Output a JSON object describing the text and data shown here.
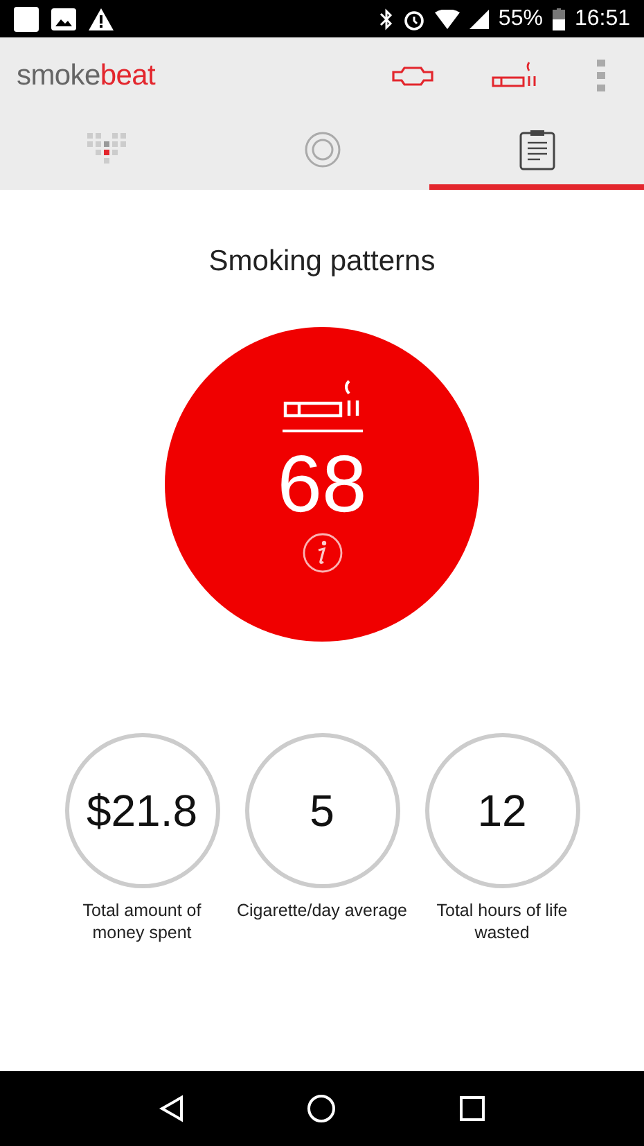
{
  "status_bar": {
    "battery": "55%",
    "time": "16:51"
  },
  "app_bar": {
    "logo_first": "smoke",
    "logo_second": "beat"
  },
  "tabs": [
    {
      "kind": "heart",
      "selected": false
    },
    {
      "kind": "ring",
      "selected": false
    },
    {
      "kind": "clipboard",
      "selected": true
    }
  ],
  "title": "Smoking patterns",
  "main_count": "68",
  "stats": [
    {
      "value": "$21.8",
      "label": "Total amount of money spent"
    },
    {
      "value": "5",
      "label": "Cigarette/day average"
    },
    {
      "value": "12",
      "label": "Total hours of life wasted"
    }
  ]
}
